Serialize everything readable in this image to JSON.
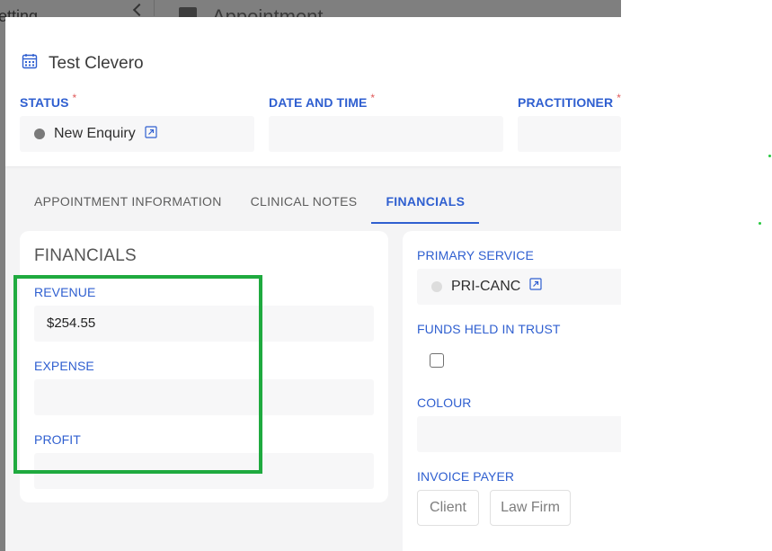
{
  "background": {
    "sidebar_fragment": "etting",
    "page_title": "Appointment"
  },
  "modal": {
    "title": "Test Clevero",
    "fields": {
      "status": {
        "label": "STATUS",
        "value": "New Enquiry"
      },
      "date_time": {
        "label": "DATE AND TIME",
        "value": ""
      },
      "practitioner": {
        "label": "PRACTITIONER",
        "value": ""
      },
      "required_mark": "*"
    },
    "tabs": [
      {
        "label": "APPOINTMENT INFORMATION"
      },
      {
        "label": "CLINICAL NOTES"
      },
      {
        "label": "FINANCIALS"
      }
    ],
    "active_tab": "FINANCIALS",
    "financials": {
      "title": "FINANCIALS",
      "revenue": {
        "label": "REVENUE",
        "value": "$254.55"
      },
      "expense": {
        "label": "EXPENSE",
        "value": ""
      },
      "profit": {
        "label": "PROFIT",
        "value": ""
      }
    },
    "right_panel": {
      "primary_service": {
        "label": "PRIMARY SERVICE",
        "value": "PRI-CANC"
      },
      "funds_held_in_trust": {
        "label": "FUNDS HELD IN TRUST",
        "checked": false
      },
      "colour": {
        "label": "COLOUR",
        "value": ""
      },
      "invoice_payer": {
        "label": "INVOICE PAYER",
        "options": [
          "Client",
          "Law Firm"
        ]
      }
    }
  },
  "colors": {
    "accent": "#2f5fd0",
    "highlight": "#1faa3f",
    "required": "#e05a5a",
    "overlay": "#7f7f7f"
  }
}
